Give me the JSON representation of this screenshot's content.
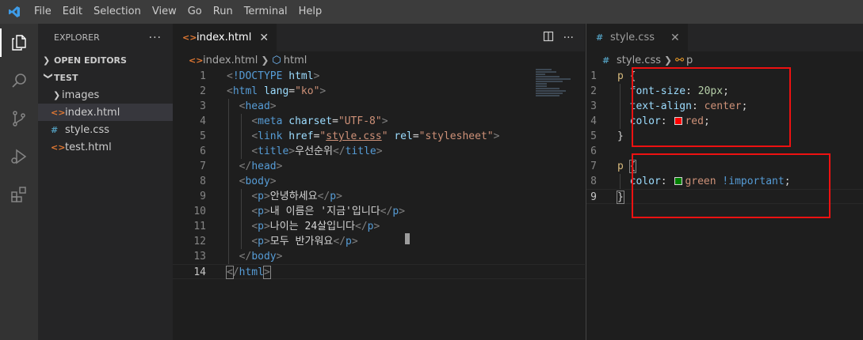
{
  "menu": [
    "File",
    "Edit",
    "Selection",
    "View",
    "Go",
    "Run",
    "Terminal",
    "Help"
  ],
  "explorer": {
    "title": "EXPLORER",
    "more": "···",
    "open_editors": "OPEN EDITORS",
    "folder": "TEST",
    "items": [
      {
        "name": "images",
        "kind": "folder"
      },
      {
        "name": "index.html",
        "kind": "html"
      },
      {
        "name": "style.css",
        "kind": "css"
      },
      {
        "name": "test.html",
        "kind": "html"
      }
    ]
  },
  "left_editor": {
    "tab_label": "index.html",
    "breadcrumb": [
      "index.html",
      "html"
    ],
    "current_line": 14
  },
  "right_editor": {
    "tab_label": "style.css",
    "breadcrumb": [
      "style.css",
      "p"
    ],
    "current_line": 9
  },
  "colors": {
    "red_swatch": "#ff0000",
    "green_swatch": "#008000",
    "highlight_box": "#ee1111"
  }
}
